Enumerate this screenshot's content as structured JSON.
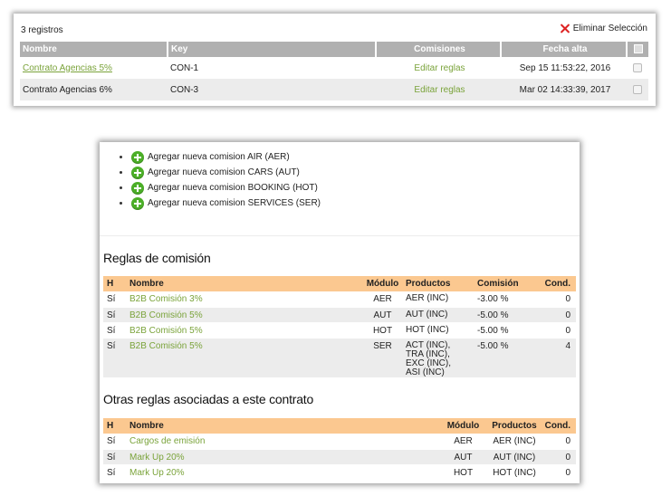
{
  "contracts": {
    "count_label": "3 registros",
    "delete_selection_label": "Eliminar Selección",
    "columns": [
      "Nombre",
      "Key",
      "Comisiones",
      "Fecha alta"
    ],
    "rows": [
      {
        "name": "Contrato Agencias 5%",
        "key": "CON-1",
        "commissions": "Editar reglas",
        "date": "Sep 15 11:53:22, 2016"
      },
      {
        "name": "Contrato Agencias 6%",
        "key": "CON-3",
        "commissions": "Editar reglas",
        "date": "Mar 02 14:33:39, 2017"
      }
    ]
  },
  "add_links": [
    "Agregar nueva comision AIR (AER)",
    "Agregar nueva comision CARS (AUT)",
    "Agregar nueva comision BOOKING (HOT)",
    "Agregar nueva comision SERVICES (SER)"
  ],
  "rules": {
    "title": "Reglas de comisión",
    "columns": [
      "H",
      "Nombre",
      "Módulo",
      "Productos",
      "Comisión",
      "Cond."
    ],
    "rows": [
      {
        "h": "Sí",
        "name": "B2B Comisión 3%",
        "module": "AER",
        "products": [
          "AER (INC)"
        ],
        "commission": "-3.00 %",
        "cond": "0"
      },
      {
        "h": "Sí",
        "name": "B2B Comisión 5%",
        "module": "AUT",
        "products": [
          "AUT (INC)"
        ],
        "commission": "-5.00 %",
        "cond": "0"
      },
      {
        "h": "Sí",
        "name": "B2B Comisión 5%",
        "module": "HOT",
        "products": [
          "HOT (INC)"
        ],
        "commission": "-5.00 %",
        "cond": "0"
      },
      {
        "h": "Sí",
        "name": "B2B Comisión 5%",
        "module": "SER",
        "products": [
          "ACT (INC),",
          "TRA (INC),",
          "EXC (INC),",
          "ASI (INC)"
        ],
        "commission": "-5.00 %",
        "cond": "4"
      }
    ]
  },
  "other_rules": {
    "title": "Otras reglas asociadas a este contrato",
    "columns": [
      "H",
      "Nombre",
      "Módulo",
      "Productos",
      "Cond."
    ],
    "rows": [
      {
        "h": "Sí",
        "name": "Cargos de emisión",
        "module": "AER",
        "products": "AER (INC)",
        "cond": "0"
      },
      {
        "h": "Sí",
        "name": "Mark Up 20%",
        "module": "AUT",
        "products": "AUT (INC)",
        "cond": "0"
      },
      {
        "h": "Sí",
        "name": "Mark Up 20%",
        "module": "HOT",
        "products": "HOT (INC)",
        "cond": "0"
      }
    ]
  },
  "colors": {
    "link_green": "#7aa33a",
    "header_orange": "#fbc890",
    "header_gray": "#b0b0b0",
    "delete_red": "#dd2222",
    "add_green": "#4caf28"
  }
}
